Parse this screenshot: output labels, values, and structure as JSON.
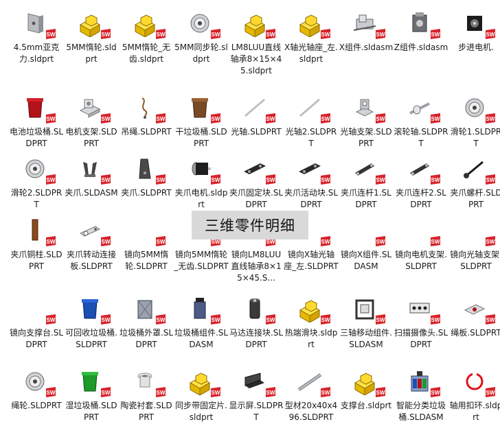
{
  "window": {
    "title": ""
  },
  "overlay": {
    "text": "三维零件明细"
  },
  "sw_badge": {
    "text": "SW",
    "color": "#d8232a"
  },
  "rows": [
    [
      {
        "label": "4.5mm亚克力.sldprt",
        "icon": "bracket-icon"
      },
      {
        "label": "5MM惰轮.sldprt",
        "icon": "yellow-block-icon"
      },
      {
        "label": "5MM惰轮_无齿.sldprt",
        "icon": "yellow-block-icon"
      },
      {
        "label": "5MM同步轮.sldprt",
        "icon": "pulley-icon"
      },
      {
        "label": "LM8LUU直线轴承8×15×45.sldprt",
        "icon": "yellow-block-icon"
      },
      {
        "label": "X轴光轴座_左.sldprt",
        "icon": "yellow-block-icon"
      },
      {
        "label": "X组件.sldasm",
        "icon": "assembly-icon"
      },
      {
        "label": "Z组件.sldasm",
        "icon": "motor-icon"
      },
      {
        "label": "步进电机.",
        "icon": "stepper-icon"
      }
    ],
    [
      {
        "label": "电池垃圾桶.SLDPRT",
        "icon": "red-bin-icon"
      },
      {
        "label": "电机支架.SLDPRT",
        "icon": "motor-mount-icon"
      },
      {
        "label": "吊绳.SLDPRT",
        "icon": "rope-icon"
      },
      {
        "label": "干垃圾桶.SLDPRT",
        "icon": "brown-bin-icon"
      },
      {
        "label": "光轴.SLDPRT",
        "icon": "rod-icon"
      },
      {
        "label": "光轴2.SLDPRT",
        "icon": "rod-icon"
      },
      {
        "label": "光轴支架.SLDPRT",
        "icon": "shaft-support-icon"
      },
      {
        "label": "滚轮轴.SLDPRT",
        "icon": "roller-shaft-icon"
      },
      {
        "label": "滑轮1.SLDPRT",
        "icon": "pulley-icon"
      }
    ],
    [
      {
        "label": "滑轮2.SLDPRT",
        "icon": "pulley-icon"
      },
      {
        "label": "夹爪.SLDASM",
        "icon": "claw-icon"
      },
      {
        "label": "夹爪.SLDPRT",
        "icon": "claw-plate-icon"
      },
      {
        "label": "夹爪电机.sldprt",
        "icon": "claw-motor-icon"
      },
      {
        "label": "夹爪固定块.SLDPRT",
        "icon": "link-block-icon"
      },
      {
        "label": "夹爪活动块.SLDPRT",
        "icon": "link-block-icon"
      },
      {
        "label": "夹爪连杆1.SLDPRT",
        "icon": "link-bar-icon"
      },
      {
        "label": "夹爪连杆2.SLDPRT",
        "icon": "link-bar-icon"
      },
      {
        "label": "夹爪螺杆.SLDPRT",
        "icon": "screw-icon"
      }
    ],
    [
      {
        "label": "夹爪铜柱.SLDPRT",
        "icon": "copper-post-icon"
      },
      {
        "label": "夹爪转动连接板.SLDPRT",
        "icon": "connector-plate-icon"
      },
      {
        "label": "镜向5MM惰轮.SLDPRT",
        "icon": "blank-icon"
      },
      {
        "label": "镜向5MM惰轮_无齿.SLDPRT",
        "icon": "blank-icon"
      },
      {
        "label": "镜向LM8LUU直线轴承8×15×45.S...",
        "icon": "blank-icon"
      },
      {
        "label": "镜向X轴光轴座_左.SLDPRT",
        "icon": "blank-icon"
      },
      {
        "label": "镜向X组件.SLDASM",
        "icon": "blank-icon"
      },
      {
        "label": "镜向电机支架.SLDPRT",
        "icon": "blank-icon"
      },
      {
        "label": "镜向光轴支架.SLDPRT",
        "icon": "blank-icon"
      }
    ],
    [
      {
        "label": "镜向支撑台.SLDPRT",
        "icon": "blank-icon"
      },
      {
        "label": "可回收垃圾桶.SLDPRT",
        "icon": "blue-bin-icon"
      },
      {
        "label": "垃圾桶外罩.SLDPRT",
        "icon": "grey-bin-icon"
      },
      {
        "label": "垃圾桶组件.SLDASM",
        "icon": "bin-assembly-icon"
      },
      {
        "label": "马达连接块.SLDPRT",
        "icon": "coupler-icon"
      },
      {
        "label": "热端滑块.sldprt",
        "icon": "yellow-block-icon"
      },
      {
        "label": "三轴移动组件.SLDASM",
        "icon": "frame-icon"
      },
      {
        "label": "扫描摄像头.SLDPRT",
        "icon": "camera-icon"
      },
      {
        "label": "绳板.SLDPRT",
        "icon": "rope-plate-icon"
      }
    ],
    [
      {
        "label": "绳轮.SLDPRT",
        "icon": "pulley-icon"
      },
      {
        "label": "湿垃圾桶.SLDPRT",
        "icon": "green-bin-icon"
      },
      {
        "label": "陶瓷衬套.SLDPRT",
        "icon": "bushing-icon"
      },
      {
        "label": "同步带固定片.sldprt",
        "icon": "yellow-block-icon"
      },
      {
        "label": "显示屏.SLDPRT",
        "icon": "display-icon"
      },
      {
        "label": "型材20x40x496.SLDPRT",
        "icon": "profile-icon"
      },
      {
        "label": "支撑台.sldprt",
        "icon": "yellow-block-icon"
      },
      {
        "label": "智能分类垃圾桶.SLDASM",
        "icon": "smart-bin-icon"
      },
      {
        "label": "轴用扣环.sldprt",
        "icon": "circlip-icon"
      }
    ]
  ]
}
